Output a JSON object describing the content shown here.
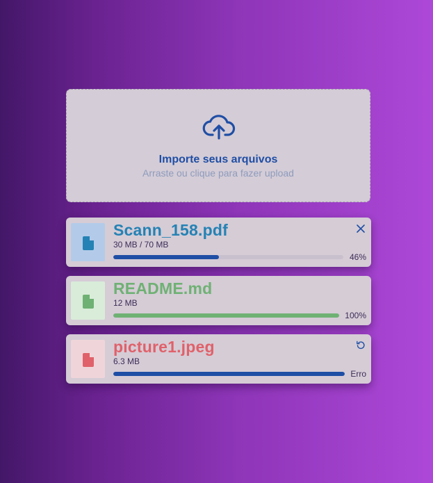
{
  "dropzone": {
    "icon": "cloud-upload-icon",
    "title": "Importe seus arquivos",
    "subtitle": "Arraste ou clique para fazer upload"
  },
  "files": [
    {
      "name": "Scann_158.pdf",
      "size": "30 MB / 70 MB",
      "status_label": "46%",
      "progress": 0.46,
      "icon": "file-icon",
      "action_icon": "close-icon",
      "color": "#2582b4",
      "thumb_bg": "#b3cbe9",
      "bar_color": "#1f4ea5"
    },
    {
      "name": "README.md",
      "size": "12 MB",
      "status_label": "100%",
      "progress": 1.0,
      "icon": "file-icon",
      "action_icon": "",
      "color": "#6fb174",
      "thumb_bg": "#d9ecd9",
      "bar_color": "#6fb174"
    },
    {
      "name": "picture1.jpeg",
      "size": "6.3 MB",
      "status_label": "Erro",
      "progress": 1.0,
      "icon": "file-icon",
      "action_icon": "retry-icon",
      "color": "#e0616a",
      "thumb_bg": "#efd5d9",
      "bar_color": "#1f4ea5"
    }
  ]
}
